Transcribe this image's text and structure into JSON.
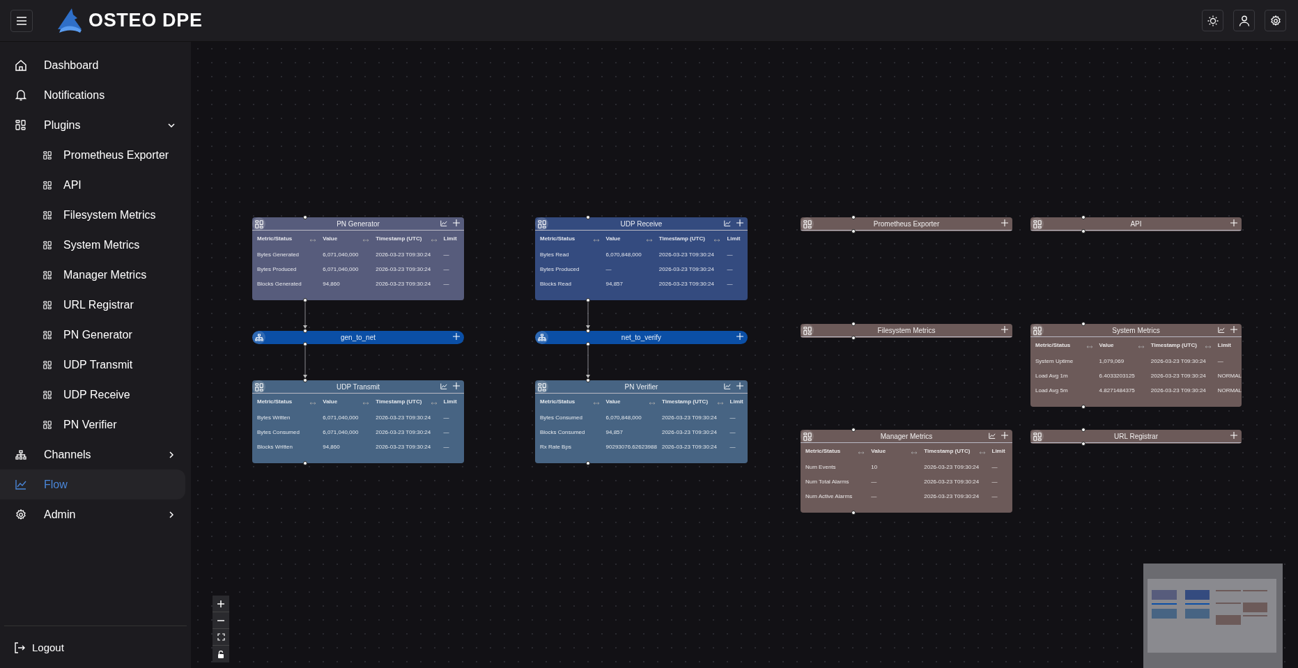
{
  "header": {
    "title": "OSTEO DPE"
  },
  "sidebar": {
    "items": [
      {
        "label": "Dashboard",
        "selected": false
      },
      {
        "label": "Notifications",
        "selected": false
      },
      {
        "label": "Plugins",
        "selected": false,
        "expanded": true,
        "children": [
          {
            "label": "Prometheus Exporter",
            "selected": false
          },
          {
            "label": "API",
            "selected": false
          },
          {
            "label": "Filesystem Metrics",
            "selected": false
          },
          {
            "label": "System Metrics",
            "selected": false
          },
          {
            "label": "Manager Metrics",
            "selected": false
          },
          {
            "label": "URL Registrar",
            "selected": false
          },
          {
            "label": "PN Generator",
            "selected": false
          },
          {
            "label": "UDP Transmit",
            "selected": false
          },
          {
            "label": "UDP Receive",
            "selected": false
          },
          {
            "label": "PN Verifier",
            "selected": false
          }
        ]
      },
      {
        "label": "Channels",
        "selected": false,
        "expanded": false
      },
      {
        "label": "Flow",
        "selected": true
      },
      {
        "label": "Admin",
        "selected": false,
        "expanded": false
      }
    ],
    "logout": "Logout"
  },
  "nodes": [
    {
      "kind": "plugin",
      "title": "PN Generator",
      "color": "#575c7c",
      "connected_below": true,
      "columns": [
        "Metric/Status",
        "Value",
        "Timestamp (UTC)",
        "Limit"
      ],
      "rows": [
        [
          "Bytes Generated",
          "6,071,040,000",
          "2026-03-23 T09:30:24",
          "—"
        ],
        [
          "Bytes Produced",
          "6,071,040,000",
          "2026-03-23 T09:30:24",
          "—"
        ],
        [
          "Blocks Generated",
          "94,860",
          "2026-03-23 T09:30:24",
          "—"
        ]
      ]
    },
    {
      "kind": "channel",
      "title": "gen_to_net",
      "color": "#0b4fa6",
      "connected_below": true
    },
    {
      "kind": "plugin",
      "title": "UDP Transmit",
      "color": "#476483",
      "connected_below": false,
      "columns": [
        "Metric/Status",
        "Value",
        "Timestamp (UTC)",
        "Limit"
      ],
      "rows": [
        [
          "Bytes Written",
          "6,071,040,000",
          "2026-03-23 T09:30:24",
          "—"
        ],
        [
          "Bytes Consumed",
          "6,071,040,000",
          "2026-03-23 T09:30:24",
          "—"
        ],
        [
          "Blocks Written",
          "94,860",
          "2026-03-23 T09:30:24",
          "—"
        ]
      ]
    },
    {
      "kind": "plugin",
      "title": "UDP Receive",
      "color": "#344b7f",
      "connected_below": true,
      "columns": [
        "Metric/Status",
        "Value",
        "Timestamp (UTC)",
        "Limit"
      ],
      "rows": [
        [
          "Bytes Read",
          "6,070,848,000",
          "2026-03-23 T09:30:24",
          "—"
        ],
        [
          "Bytes Produced",
          "—",
          "2026-03-23 T09:30:24",
          "—"
        ],
        [
          "Blocks Read",
          "94,857",
          "2026-03-23 T09:30:24",
          "—"
        ]
      ]
    },
    {
      "kind": "channel",
      "title": "net_to_verify",
      "color": "#0b4fa6",
      "connected_below": true
    },
    {
      "kind": "plugin",
      "title": "PN Verifier",
      "color": "#476483",
      "connected_below": false,
      "columns": [
        "Metric/Status",
        "Value",
        "Timestamp (UTC)",
        "Limit"
      ],
      "rows": [
        [
          "Bytes Consumed",
          "6,070,848,000",
          "2026-03-23 T09:30:24",
          "—"
        ],
        [
          "Blocks Consumed",
          "94,857",
          "2026-03-23 T09:30:24",
          "—"
        ],
        [
          "Rx Rate Bps",
          "90293076.62623988",
          "2026-03-23 T09:30:24",
          "—"
        ]
      ]
    },
    {
      "kind": "plugin",
      "title": "Prometheus Exporter",
      "color": "#6c5a59",
      "connected_below": false
    },
    {
      "kind": "plugin",
      "title": "API",
      "color": "#6c5a59",
      "connected_below": false
    },
    {
      "kind": "plugin",
      "title": "Filesystem Metrics",
      "color": "#6c5a59",
      "connected_below": false
    },
    {
      "kind": "plugin",
      "title": "System Metrics",
      "color": "#6c5a59",
      "connected_below": false,
      "columns": [
        "Metric/Status",
        "Value",
        "Timestamp (UTC)",
        "Limit"
      ],
      "rows": [
        [
          "System Uptime",
          "1,079,069",
          "2026-03-23 T09:30:24",
          "—"
        ],
        [
          "Load Avg 1m",
          "6.4033203125",
          "2026-03-23 T09:30:24",
          "NORMAL"
        ],
        [
          "Load Avg 5m",
          "4.8271484375",
          "2026-03-23 T09:30:24",
          "NORMAL"
        ]
      ]
    },
    {
      "kind": "plugin",
      "title": "Manager Metrics",
      "color": "#6c5a59",
      "connected_below": false,
      "columns": [
        "Metric/Status",
        "Value",
        "Timestamp (UTC)",
        "Limit"
      ],
      "rows": [
        [
          "Num Events",
          "10",
          "2026-03-23 T09:30:24",
          "—"
        ],
        [
          "Num Total Alarms",
          "—",
          "2026-03-23 T09:30:24",
          "—"
        ],
        [
          "Num Active Alarms",
          "—",
          "2026-03-23 T09:30:24",
          "—"
        ]
      ]
    },
    {
      "kind": "plugin",
      "title": "URL Registrar",
      "color": "#6c5a59",
      "connected_below": false
    }
  ]
}
